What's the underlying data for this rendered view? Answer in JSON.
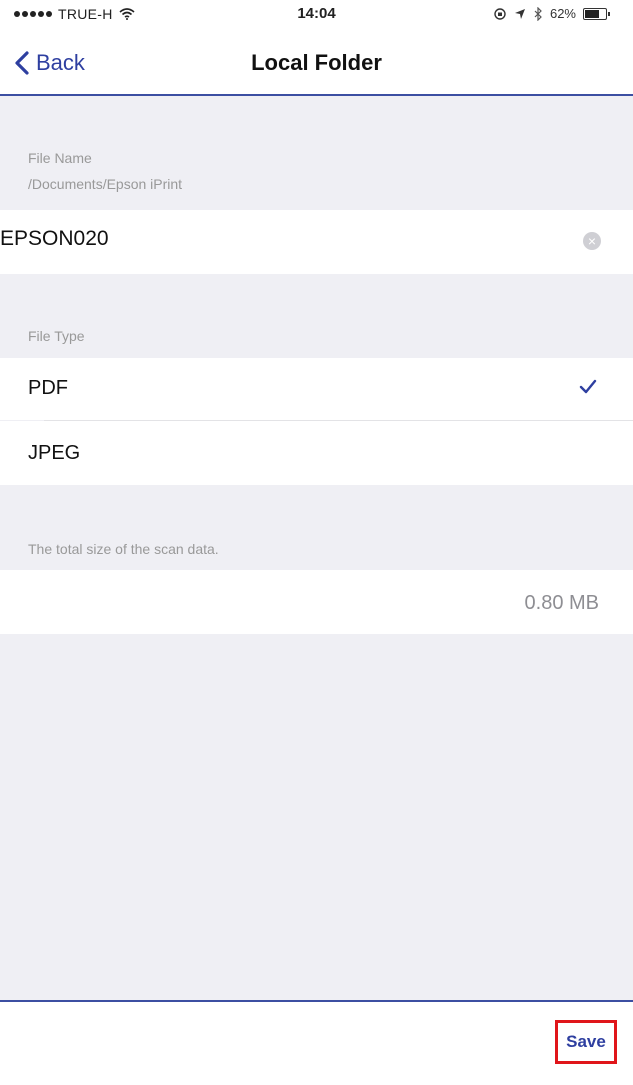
{
  "status_bar": {
    "carrier": "TRUE-H",
    "time": "14:04",
    "battery": "62%",
    "battery_level": 0.62
  },
  "nav": {
    "back_label": "Back",
    "title": "Local Folder"
  },
  "file_name": {
    "header": "File Name",
    "path": "/Documents/Epson iPrint",
    "value": "EPSON020"
  },
  "file_type": {
    "header": "File Type",
    "options": [
      {
        "label": "PDF",
        "selected": true
      },
      {
        "label": "JPEG",
        "selected": false
      }
    ]
  },
  "scan_size": {
    "header": "The total size of the scan data.",
    "value": "0.80 MB"
  },
  "toolbar": {
    "save_label": "Save"
  },
  "colors": {
    "accent": "#2e3fa0",
    "highlight_border": "#e0151a",
    "background": "#efeff4"
  }
}
